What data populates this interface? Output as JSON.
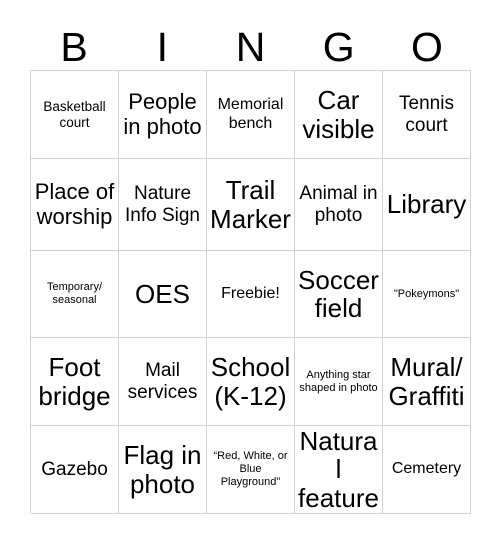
{
  "header": {
    "letters": [
      "B",
      "I",
      "N",
      "G",
      "O"
    ]
  },
  "grid": {
    "rows": [
      [
        {
          "text": "Basketball court",
          "size": "sm"
        },
        {
          "text": "People in photo",
          "size": "xl"
        },
        {
          "text": "Memorial bench",
          "size": "md"
        },
        {
          "text": "Car visible",
          "size": "xxl"
        },
        {
          "text": "Tennis court",
          "size": "lg"
        }
      ],
      [
        {
          "text": "Place of worship",
          "size": "xl"
        },
        {
          "text": "Nature Info Sign",
          "size": "lg"
        },
        {
          "text": "Trail Marker",
          "size": "xxl"
        },
        {
          "text": "Animal in photo",
          "size": "lg"
        },
        {
          "text": "Library",
          "size": "xxl"
        }
      ],
      [
        {
          "text": "Temporary/ seasonal",
          "size": "xs"
        },
        {
          "text": "OES",
          "size": "xxl"
        },
        {
          "text": "Freebie!",
          "size": "md"
        },
        {
          "text": "Soccer field",
          "size": "xxl"
        },
        {
          "text": "\"Pokeymons\"",
          "size": "xs"
        }
      ],
      [
        {
          "text": "Foot bridge",
          "size": "xxl"
        },
        {
          "text": "Mail services",
          "size": "lg"
        },
        {
          "text": "School (K-12)",
          "size": "xxl"
        },
        {
          "text": "Anything star shaped in photo",
          "size": "xs"
        },
        {
          "text": "Mural/ Graffiti",
          "size": "xxl"
        }
      ],
      [
        {
          "text": "Gazebo",
          "size": "lg"
        },
        {
          "text": "Flag in photo",
          "size": "xxl"
        },
        {
          "text": "“Red, White, or Blue Playground\"",
          "size": "xs"
        },
        {
          "text": "Natural feature",
          "size": "xxl"
        },
        {
          "text": "Cemetery",
          "size": "md"
        }
      ]
    ]
  },
  "colors": {
    "background": "#ffffff",
    "text": "#000000",
    "grid_line": "#d2d2d2"
  }
}
